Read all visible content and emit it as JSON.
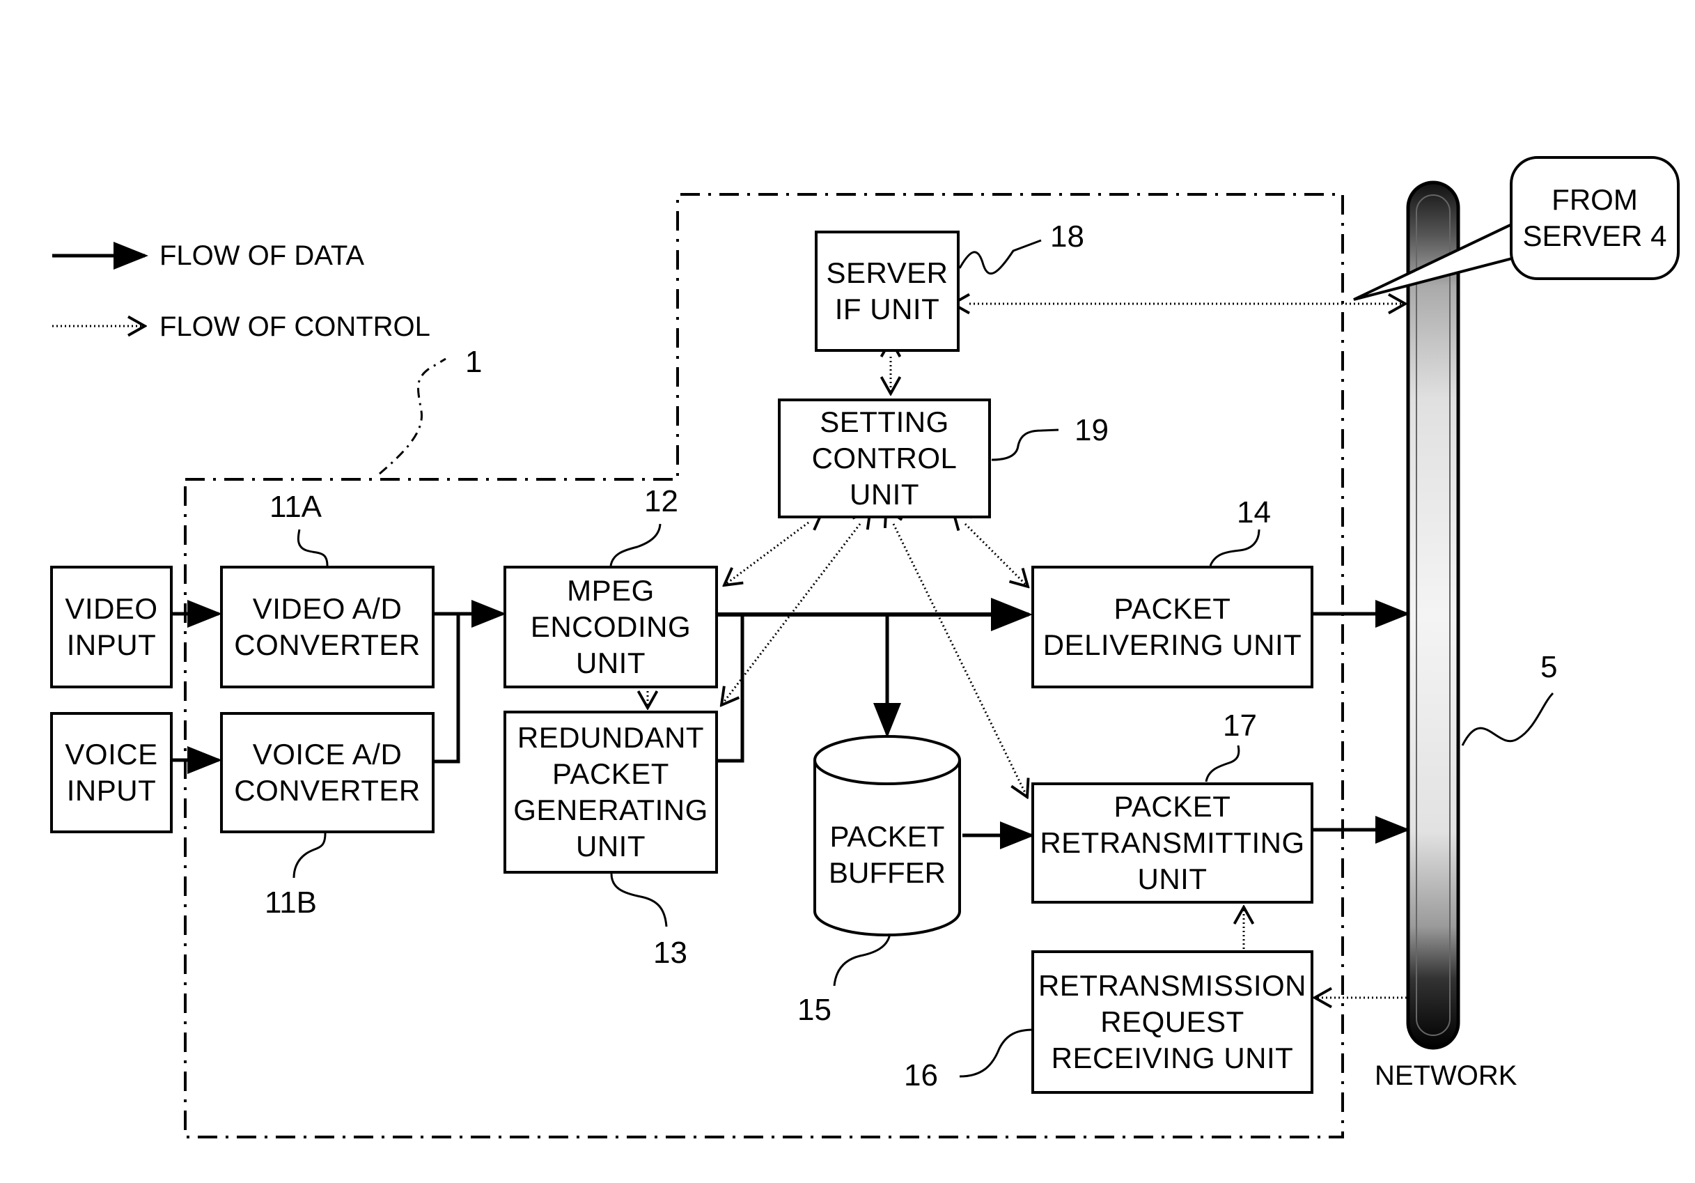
{
  "legend": {
    "data_flow": "FLOW OF DATA",
    "control_flow": "FLOW OF CONTROL"
  },
  "device_ref": "1",
  "blocks": {
    "video_input": {
      "label": "VIDEO\nINPUT"
    },
    "voice_input": {
      "label": "VOICE\nINPUT"
    },
    "video_ad": {
      "label": "VIDEO A/D\nCONVERTER",
      "ref": "11A"
    },
    "voice_ad": {
      "label": "VOICE A/D\nCONVERTER",
      "ref": "11B"
    },
    "mpeg": {
      "label": "MPEG\nENCODING\nUNIT",
      "ref": "12"
    },
    "redundant": {
      "label": "REDUNDANT\nPACKET\nGENERATING\nUNIT",
      "ref": "13"
    },
    "delivering": {
      "label": "PACKET\nDELIVERING UNIT",
      "ref": "14"
    },
    "buffer": {
      "label": "PACKET\nBUFFER",
      "ref": "15"
    },
    "retrans_request": {
      "label": "RETRANSMISSION\nREQUEST\nRECEIVING UNIT",
      "ref": "16"
    },
    "retransmitting": {
      "label": "PACKET\nRETRANSMITTING\nUNIT",
      "ref": "17"
    },
    "server_if": {
      "label": "SERVER\nIF UNIT",
      "ref": "18"
    },
    "setting_control": {
      "label": "SETTING\nCONTROL\nUNIT",
      "ref": "19"
    }
  },
  "network": {
    "label": "NETWORK",
    "ref": "5"
  },
  "callout": {
    "label": "FROM\nSERVER 4"
  }
}
